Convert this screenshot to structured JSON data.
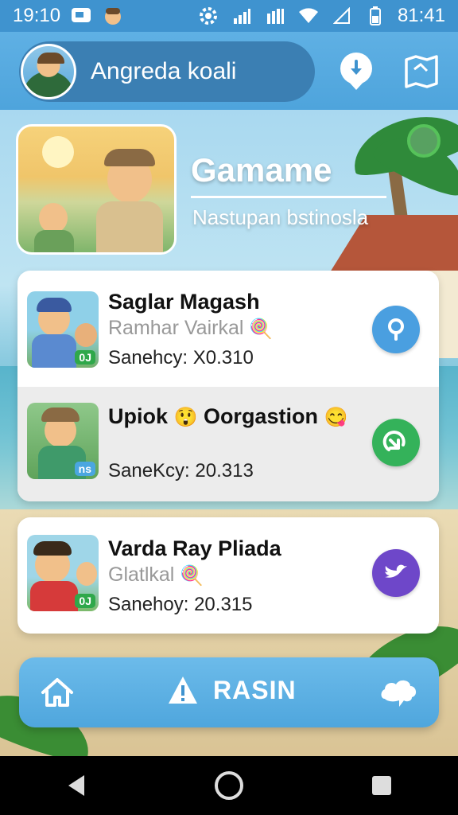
{
  "status_bar": {
    "time": "19:10",
    "battery_time": "81:41",
    "icons": [
      "message-icon",
      "avatar-icon",
      "settings-icon",
      "signal-icon",
      "signal-icon",
      "wifi-icon",
      "signal-empty-icon",
      "battery-icon"
    ]
  },
  "header": {
    "profile_name": "Angreda koali",
    "icons": [
      "avatar-icon",
      "location-pin-icon",
      "map-icon"
    ]
  },
  "banner": {
    "title": "Gamame",
    "subtitle": "Nastupan bstinosla"
  },
  "cards": [
    {
      "rows": [
        {
          "title": "Saglar Magash",
          "subtitle": "Ramhar Vairkal",
          "subtitle_emoji": "🍭",
          "meta": "Sanehcy: X0.310",
          "thumb_tag": "0J",
          "action_icon": "search-icon",
          "action_color": "#4a9fe0"
        },
        {
          "title": "Upiok",
          "title_emoji_1": "😲",
          "title_middle": "Oorgastion",
          "title_emoji_2": "😋",
          "meta": "SaneKcy: 20.313",
          "thumb_tag": "ns",
          "action_icon": "share-icon",
          "action_color": "#34b25a"
        }
      ]
    },
    {
      "rows": [
        {
          "title": "Varda Ray Pliada",
          "subtitle": "Glatlkal",
          "subtitle_emoji": "🍭",
          "meta": "Sanehoy: 20.315",
          "thumb_tag": "0J",
          "action_icon": "bird-icon",
          "action_color": "#6e47c9"
        }
      ]
    }
  ],
  "action_bar": {
    "label": "RASIN",
    "icons": [
      "home-icon",
      "warning-icon",
      "chat-icon"
    ]
  },
  "nav_bar": {
    "icons": [
      "back-icon",
      "home-circle-icon",
      "recents-icon"
    ]
  }
}
